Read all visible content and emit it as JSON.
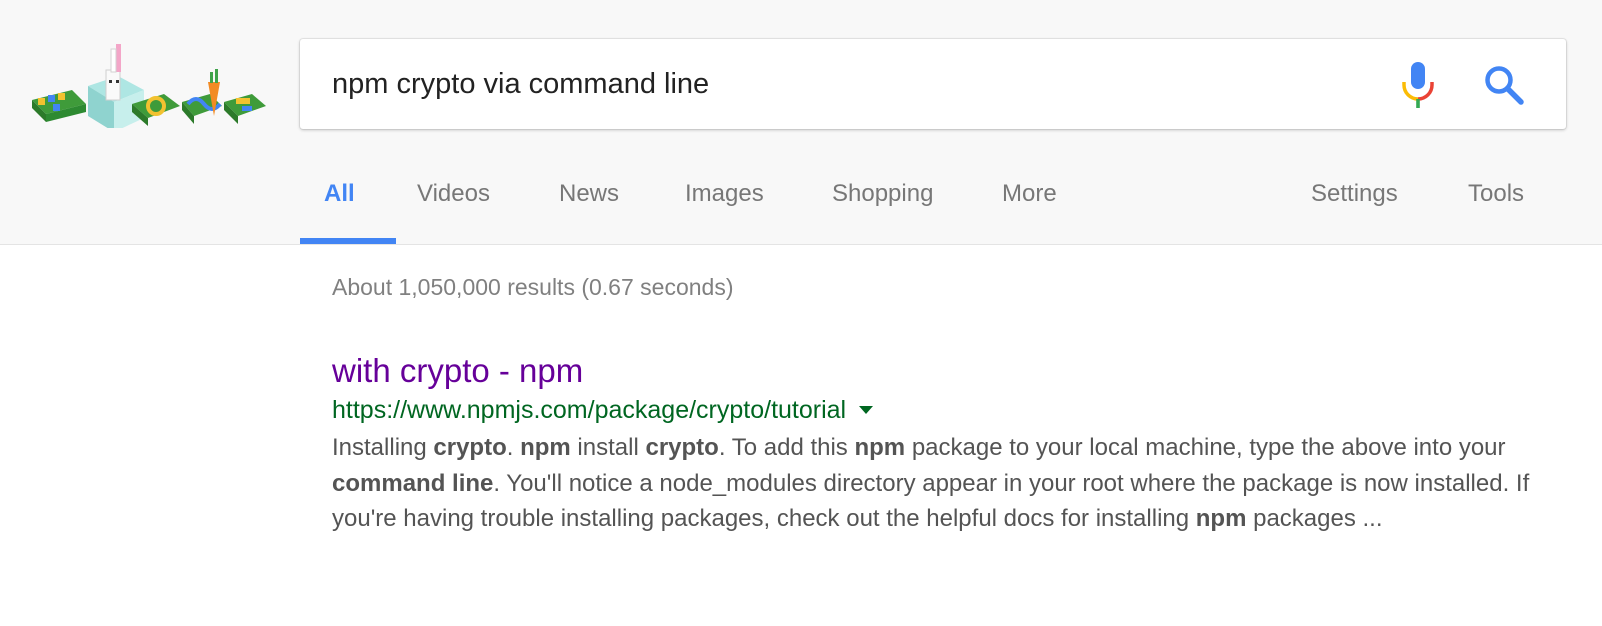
{
  "search": {
    "query": "npm crypto via command line"
  },
  "tabs": [
    {
      "label": "All",
      "active": true
    },
    {
      "label": "Videos"
    },
    {
      "label": "News"
    },
    {
      "label": "Images"
    },
    {
      "label": "Shopping"
    },
    {
      "label": "More"
    },
    {
      "label": "Settings"
    },
    {
      "label": "Tools"
    }
  ],
  "results_info": {
    "stats": "About 1,050,000 results (0.67 seconds)"
  },
  "result": {
    "title": "with crypto - npm",
    "url": "https://www.npmjs.com/package/crypto/tutorial",
    "snippet": [
      {
        "t": "Installing ",
        "b": false
      },
      {
        "t": "crypto",
        "b": true
      },
      {
        "t": ". ",
        "b": false
      },
      {
        "t": "npm",
        "b": true
      },
      {
        "t": " install ",
        "b": false
      },
      {
        "t": "crypto",
        "b": true
      },
      {
        "t": ". To add this ",
        "b": false
      },
      {
        "t": "npm",
        "b": true
      },
      {
        "t": " package to your local machine, type the above into your ",
        "b": false
      },
      {
        "t": "command line",
        "b": true
      },
      {
        "t": ". You'll notice a node_modules directory appear in your root where the package is now installed. If you're having trouble installing packages, check out the helpful docs for installing ",
        "b": false
      },
      {
        "t": "npm",
        "b": true
      },
      {
        "t": " packages ...",
        "b": false
      }
    ]
  },
  "icons": {
    "logo": "google-doodle-logo",
    "mic": "microphone-icon",
    "search": "search-icon",
    "url_menu": "dropdown-arrow-icon"
  },
  "colors": {
    "accent": "#4285f4",
    "visited_link": "#660099",
    "url_green": "#006621",
    "muted": "#777777"
  }
}
